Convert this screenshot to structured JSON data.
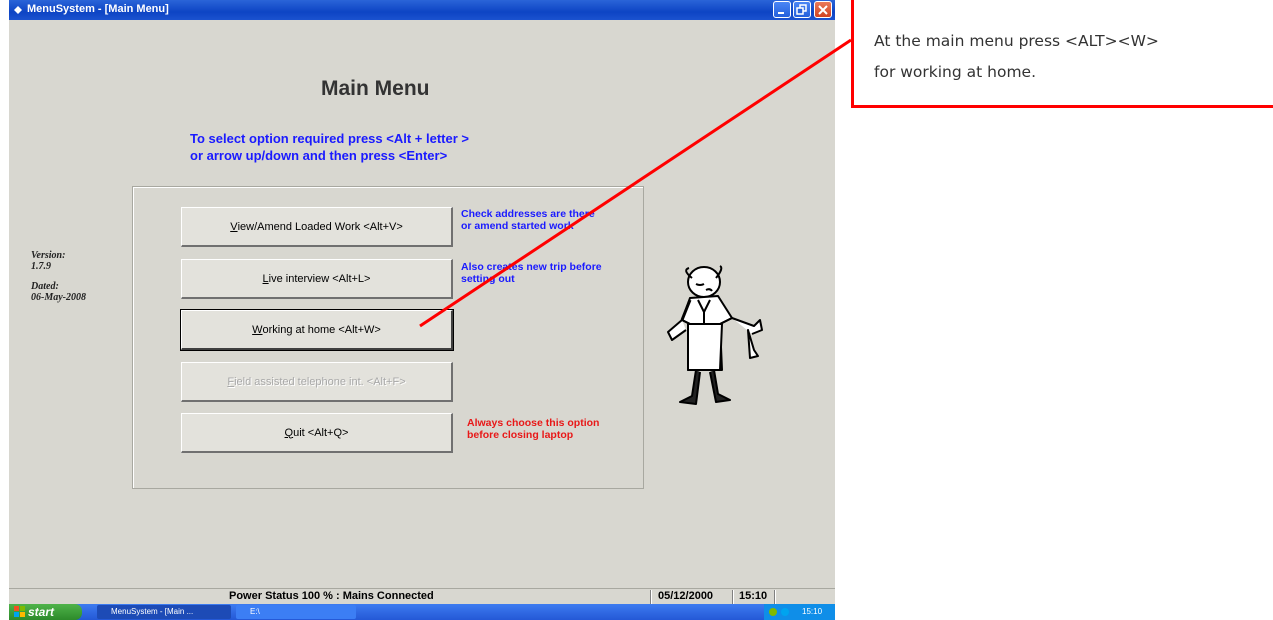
{
  "window": {
    "title": "MenuSystem - [Main Menu]"
  },
  "main": {
    "heading": "Main Menu",
    "instruction_line1": "To select option required press <Alt + letter >",
    "instruction_line2": "or arrow up/down and then press <Enter>"
  },
  "version_info": {
    "version_label": "Version:",
    "version_value": "1.7.9",
    "dated_label": "Dated:",
    "dated_value": "06-May-2008"
  },
  "buttons": [
    {
      "label": "View/Amend Loaded Work <Alt+V>",
      "hotkey": "V",
      "rest": "iew/Amend Loaded Work <Alt+V>",
      "description": "Check addresses are there\nor amend started work",
      "description_color": "blue",
      "state": "normal"
    },
    {
      "label": "Live interview <Alt+L>",
      "hotkey": "L",
      "rest": "ive interview <Alt+L>",
      "description": "Also creates new trip before\nsetting out",
      "description_color": "blue",
      "state": "normal"
    },
    {
      "label": "Working at home <Alt+W>",
      "hotkey": "W",
      "rest": "orking at home <Alt+W>",
      "description": "",
      "state": "focused"
    },
    {
      "label": "Field assisted telephone int. <Alt+F>",
      "hotkey": "F",
      "rest": "ield assisted telephone int. <Alt+F>",
      "description": "",
      "state": "disabled"
    },
    {
      "label": "Quit <Alt+Q>",
      "hotkey": "Q",
      "rest": "uit <Alt+Q>",
      "description": "Always choose this option\nbefore closing laptop",
      "description_color": "red",
      "state": "normal"
    }
  ],
  "statusbar": {
    "power": "Power Status 100 % : Mains Connected",
    "date": "05/12/2000",
    "time": "15:10"
  },
  "taskbar": {
    "start_label": "start",
    "task1": "MenuSystem - [Main ...",
    "task2": "E:\\",
    "clock": "15:10"
  },
  "annotation": {
    "line1": "At the main menu press <ALT><W>",
    "line2": "for working at home."
  },
  "colors": {
    "titlebar": "#0d44c4",
    "instruction_text": "#1a1aff",
    "warning_text": "#e81818",
    "callout_border": "#ff0000",
    "window_bg": "#d8d7d0"
  }
}
